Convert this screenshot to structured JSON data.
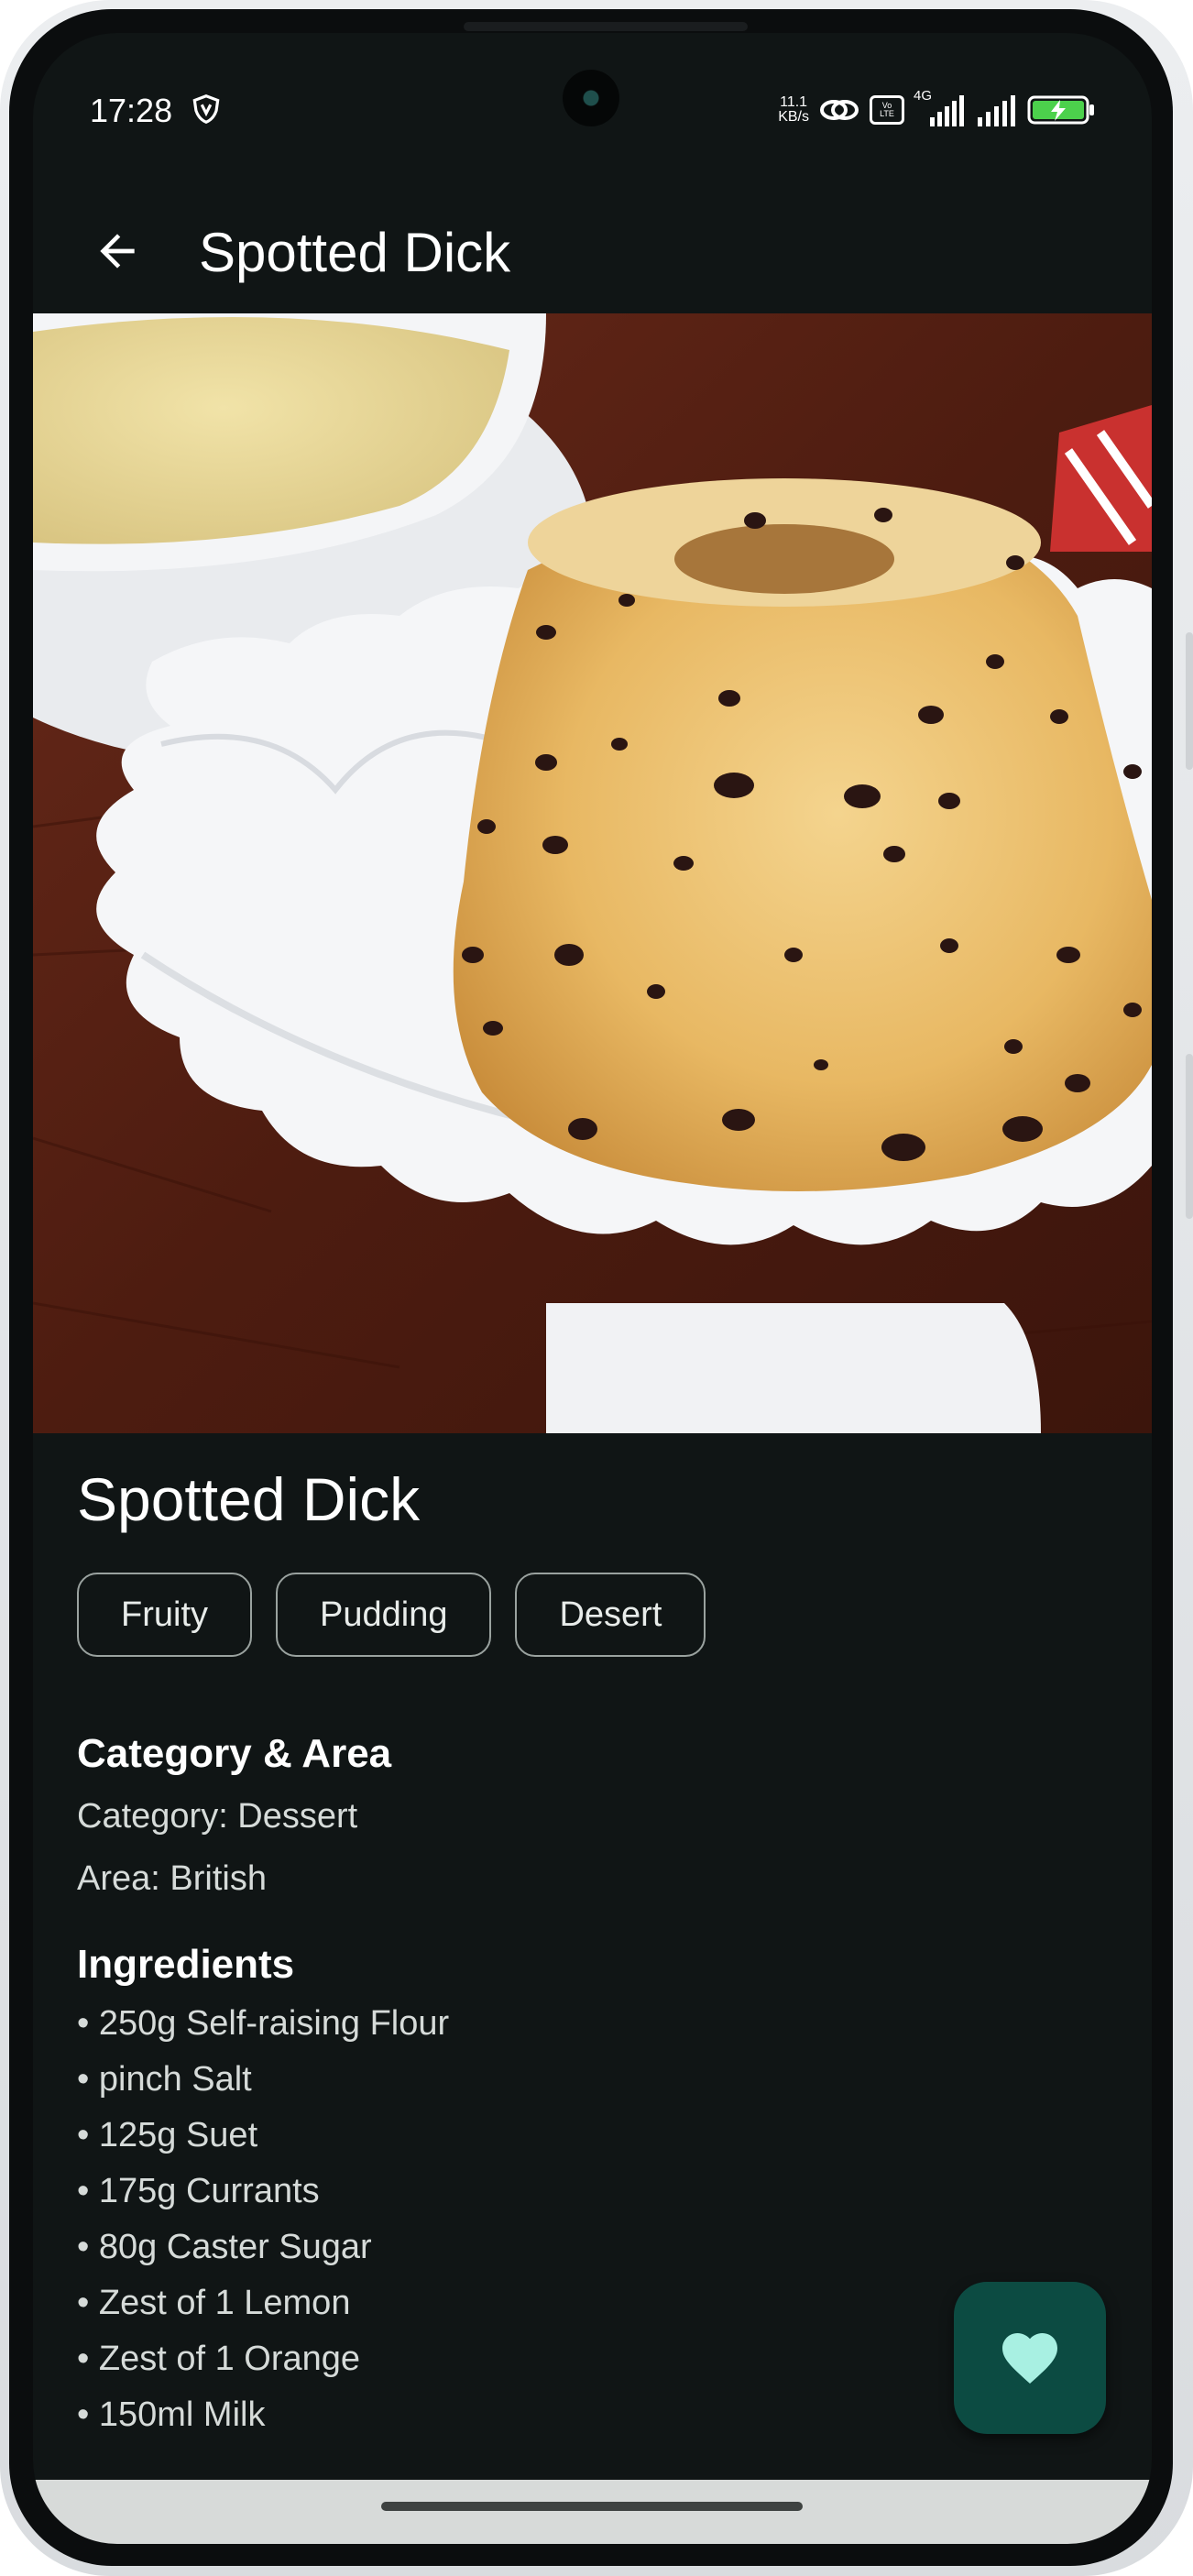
{
  "status_bar": {
    "time": "17:28",
    "net_speed_value": "11.1",
    "net_speed_unit": "KB/s",
    "volte_label": "Vo LTE",
    "network_label": "4G",
    "icons": [
      "vpn-shield-icon",
      "hotspot-link-icon",
      "volte-icon",
      "signal-4g-icon",
      "signal-icon",
      "battery-charging-icon"
    ]
  },
  "app_bar": {
    "back_icon": "arrow-back-icon",
    "title": "Spotted Dick"
  },
  "meal": {
    "name": "Spotted Dick",
    "tags": [
      "Fruity",
      "Pudding",
      "Desert"
    ]
  },
  "category_area": {
    "title": "Category & Area",
    "category": "Category: Dessert",
    "area": "Area: British"
  },
  "ingredients": {
    "title": "Ingredients",
    "items": [
      "• 250g Self-raising Flour",
      "• pinch Salt",
      "• 125g Suet",
      "• 175g Currants",
      "• 80g Caster Sugar",
      "• Zest of 1 Lemon",
      "• Zest of 1 Orange",
      "• 150ml Milk"
    ]
  },
  "fab": {
    "icon": "heart-icon"
  },
  "colors": {
    "background": "#101515",
    "fab": "#0c4b42",
    "fab_icon": "#a8f0e2",
    "text": "#ffffff",
    "secondary_text": "#d6dbd9"
  }
}
